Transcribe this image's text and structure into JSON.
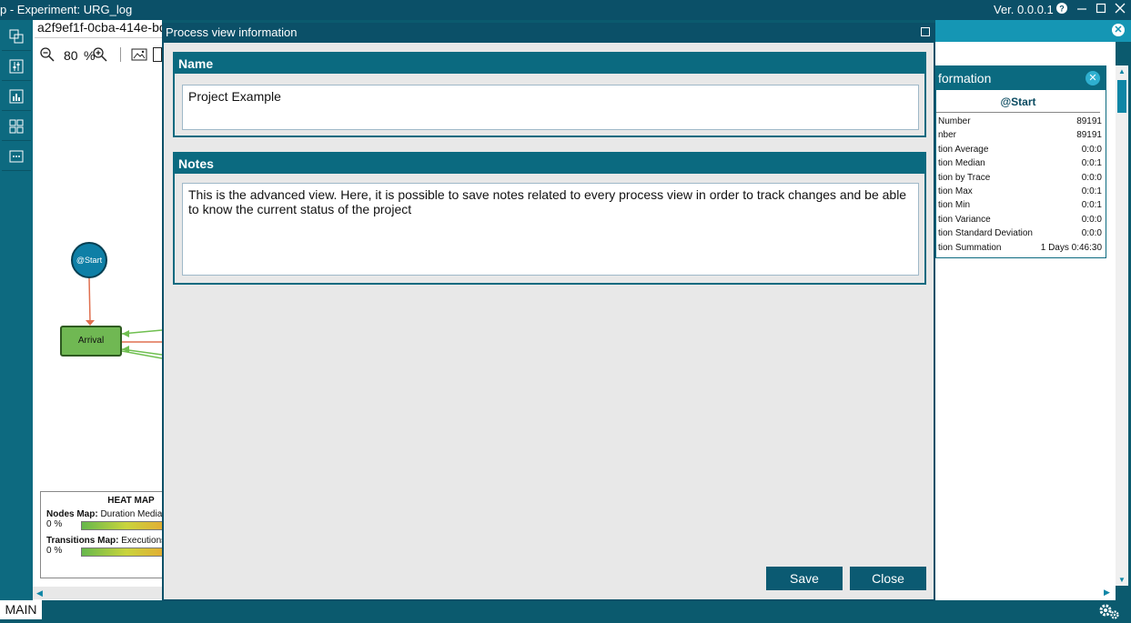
{
  "window": {
    "title": "p  -  Experiment: URG_log",
    "version": "Ver. 0.0.0.1",
    "help_icon": "question-icon",
    "minimize_icon": "minimize-icon",
    "maximize_icon": "maximize-icon",
    "close_icon": "close-icon"
  },
  "canvas": {
    "tab_title": "a2f9ef1f-0cba-414e-bd",
    "zoom_value": "80",
    "zoom_unit": "%",
    "start_node_label": "@Start",
    "arrival_node_label": "Arrival",
    "heatmap": {
      "title": "HEAT MAP",
      "nodes_label": "Nodes Map:",
      "nodes_value": "Duration Media",
      "nodes_pct": "0 %",
      "transitions_label": "Transitions Map:",
      "transitions_value": "Executions",
      "transitions_pct": "0 %"
    }
  },
  "info_panel": {
    "header": "formation",
    "subheader": "@Start",
    "rows": [
      {
        "label": "Number",
        "value": "89191"
      },
      {
        "label": "nber",
        "value": "89191"
      },
      {
        "label": "tion Average",
        "value": "0:0:0"
      },
      {
        "label": "tion Median",
        "value": "0:0:1"
      },
      {
        "label": "tion by Trace",
        "value": "0:0:0"
      },
      {
        "label": "tion Max",
        "value": "0:0:1"
      },
      {
        "label": "tion Min",
        "value": "0:0:1"
      },
      {
        "label": "tion Variance",
        "value": "0:0:0"
      },
      {
        "label": "tion Standard Deviation",
        "value": "0:0:0"
      },
      {
        "label": "tion Summation",
        "value": "1 Days 0:46:30"
      }
    ]
  },
  "dialog": {
    "title": "Process view information",
    "name_header": "Name",
    "name_value": "Project Example",
    "notes_header": "Notes",
    "notes_value": "This is the advanced view. Here, it is possible to save notes related to every process view in order to track changes and be able to know the current status of the project",
    "save_label": "Save",
    "close_label": "Close"
  },
  "bottom": {
    "main_tab": "MAIN"
  },
  "colors": {
    "dark_teal": "#0b5068",
    "panel_teal": "#0b6a80",
    "accent": "#1596b4",
    "button": "#0b5a72"
  }
}
